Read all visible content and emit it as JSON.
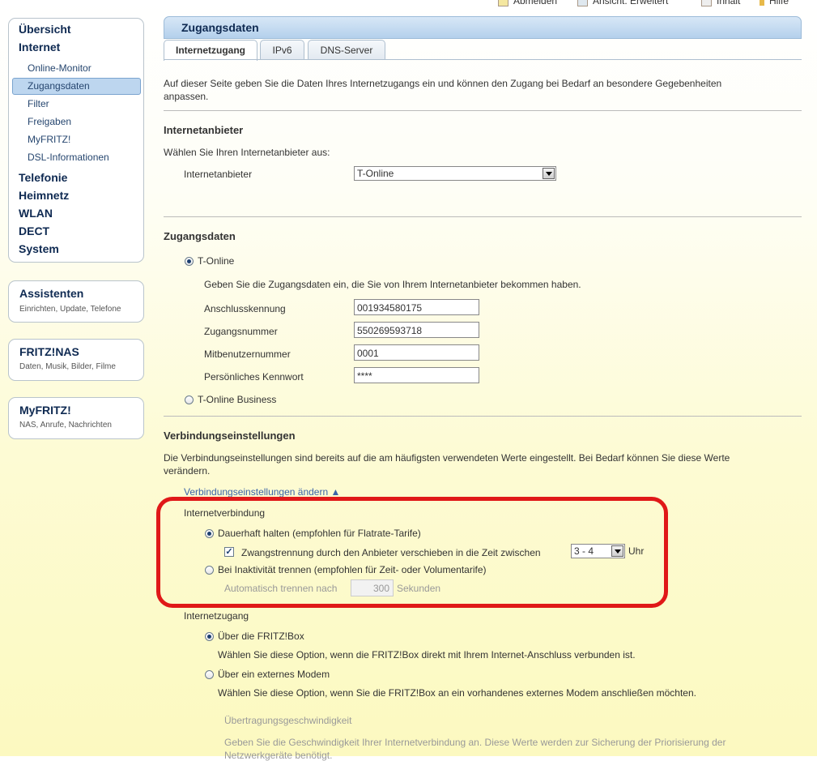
{
  "toplinks": {
    "logout": "Abmelden",
    "view": "Ansicht: Erweitert",
    "contents": "Inhalt",
    "help": "Hilfe"
  },
  "nav": {
    "overview": "Übersicht",
    "internet": "Internet",
    "sub": [
      "Online-Monitor",
      "Zugangsdaten",
      "Filter",
      "Freigaben",
      "MyFRITZ!",
      "DSL-Informationen"
    ],
    "telefonie": "Telefonie",
    "heimnetz": "Heimnetz",
    "wlan": "WLAN",
    "dect": "DECT",
    "system": "System"
  },
  "boxes": {
    "assistants": {
      "title": "Assistenten",
      "sub": "Einrichten, Update, Telefone"
    },
    "nas": {
      "title": "FRITZ!NAS",
      "sub": "Daten, Musik, Bilder, Filme"
    },
    "myfritz": {
      "title": "MyFRITZ!",
      "sub": "NAS, Anrufe, Nachrichten"
    }
  },
  "page": {
    "title": "Zugangsdaten",
    "tabs": [
      "Internetzugang",
      "IPv6",
      "DNS-Server"
    ],
    "intro1": "Auf dieser Seite geben Sie die Daten Ihres Internetzugangs ein und können den Zugang bei Bedarf an besondere Gegebenheiten",
    "intro2": "anpassen."
  },
  "provider": {
    "heading": "Internetanbieter",
    "prompt": "Wählen Sie Ihren Internetanbieter aus:",
    "label": "Internetanbieter",
    "value": "T-Online"
  },
  "access": {
    "heading": "Zugangsdaten",
    "option1": "T-Online",
    "info": "Geben Sie die Zugangsdaten ein, die Sie von Ihrem Internetanbieter bekommen haben.",
    "fields": [
      {
        "label": "Anschlusskennung",
        "value": "001934580175"
      },
      {
        "label": "Zugangsnummer",
        "value": "550269593718"
      },
      {
        "label": "Mitbenutzernummer",
        "value": "0001"
      },
      {
        "label": "Persönliches Kennwort",
        "value": "****"
      }
    ],
    "option2": "T-Online Business"
  },
  "conn": {
    "heading": "Verbindungseinstellungen",
    "info1": "Die Verbindungseinstellungen sind bereits auf die am häufigsten verwendeten Werte eingestellt. Bei Bedarf können Sie diese Werte",
    "info2": "verändern.",
    "toggle": "Verbindungseinstellungen ändern ▲",
    "internetverbindung": "Internetverbindung",
    "keep": "Dauerhaft halten (empfohlen für Flatrate-Tarife)",
    "force": "Zwangstrennung durch den Anbieter verschieben in die Zeit zwischen",
    "force_value": "3 - 4",
    "uhr": "Uhr",
    "idle": "Bei Inaktivität trennen (empfohlen für Zeit- oder Volumentarife)",
    "auto": "Automatisch trennen nach",
    "auto_value": "300",
    "sek": "Sekunden",
    "internetzugang": "Internetzugang",
    "fritz": "Über die FRITZ!Box",
    "fritz_info": "Wählen Sie diese Option, wenn die FRITZ!Box direkt mit Ihrem Internet-Anschluss verbunden ist.",
    "modem": "Über ein externes Modem",
    "modem_info": "Wählen Sie diese Option, wenn Sie die FRITZ!Box an ein vorhandenes externes Modem anschließen möchten.",
    "speed": "Übertragungsgeschwindigkeit",
    "speed_info1": "Geben Sie die Geschwindigkeit Ihrer Internetverbindung an. Diese Werte werden zur Sicherung der Priorisierung der",
    "speed_info2": "Netzwerkgeräte benötigt."
  }
}
